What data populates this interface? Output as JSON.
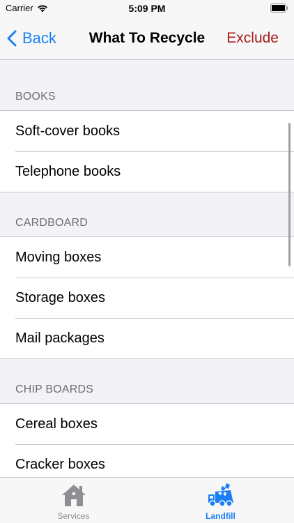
{
  "status_bar": {
    "carrier": "Carrier",
    "time": "5:09 PM"
  },
  "nav": {
    "back_label": "Back",
    "title": "What To Recycle",
    "exclude_label": "Exclude"
  },
  "sections": [
    {
      "header": "BOOKS",
      "items": [
        "Soft-cover books",
        "Telephone books"
      ]
    },
    {
      "header": "CARDBOARD",
      "items": [
        "Moving boxes",
        "Storage boxes",
        "Mail packages"
      ]
    },
    {
      "header": "CHIP BOARDS",
      "items": [
        "Cereal boxes",
        "Cracker boxes"
      ]
    }
  ],
  "tabs": [
    {
      "label": "Services",
      "icon": "house-icon",
      "active": false
    },
    {
      "label": "Landfill",
      "icon": "garbage-truck-icon",
      "active": true
    }
  ],
  "colors": {
    "accent": "#1a7ff5",
    "destructive": "#a31b1b",
    "section_text": "#6d6d72",
    "background": "#f2f2f7"
  }
}
